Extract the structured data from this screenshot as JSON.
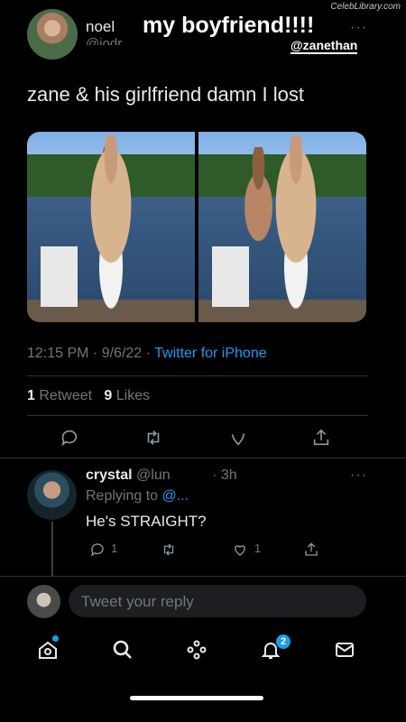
{
  "watermark": "CelebLibrary.com",
  "tweet": {
    "author_name": "noel",
    "author_handle": "@jodr...",
    "more": "···",
    "text": "zane & his girlfriend damn I lost",
    "time": "12:15 PM · 9/6/22 · ",
    "source": "Twitter for iPhone",
    "retweets": "1",
    "retweets_label": "Retweet",
    "likes": "9",
    "likes_label": "Likes"
  },
  "story_overlay": {
    "title": "my boyfriend!!!!",
    "tag": "@zanethan"
  },
  "reply": {
    "author_name": "crystal",
    "author_handle": "@lun",
    "time": "· 3h",
    "more": "···",
    "replying_label": "Replying to",
    "replying_handle": "@...",
    "text": "He's STRAIGHT?",
    "reply_count": "1",
    "like_count": "1"
  },
  "composer": {
    "placeholder": "Tweet your reply"
  },
  "nav": {
    "notifications_badge": "2"
  },
  "colors": {
    "accent": "#1d9bf0",
    "background": "#000000",
    "muted": "#71767b"
  }
}
